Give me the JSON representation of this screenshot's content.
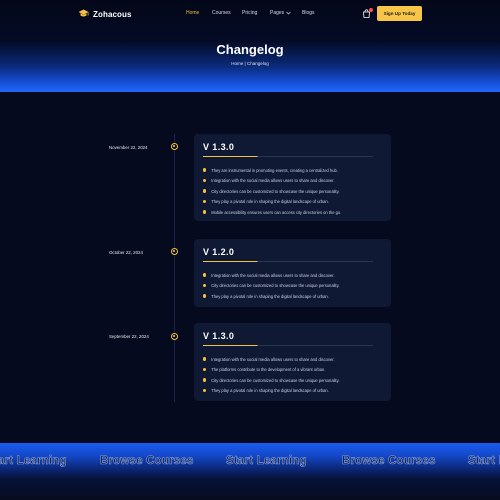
{
  "brand": {
    "name": "Zohacous",
    "accent": "#f5c142"
  },
  "nav": {
    "items": [
      {
        "label": "Home",
        "active": true
      },
      {
        "label": "Courses",
        "active": false
      },
      {
        "label": "Pricing",
        "active": false
      },
      {
        "label": "Pages",
        "active": false
      },
      {
        "label": "Blogs",
        "active": false
      }
    ],
    "cta_label": "Sign Up Today",
    "cart_icon": "shopping-bag-icon"
  },
  "hero": {
    "title": "Changelog",
    "breadcrumb": {
      "home": "Home",
      "separator": " | ",
      "current": "Changelog"
    }
  },
  "changelog": [
    {
      "date": "November 22, 2024",
      "version": "V 1.3.0",
      "items": [
        "They are instrumental in promoting events, creating a centralized hub.",
        "Integration with the social media allows users to share and discover.",
        "City directories can be customized to showcase the unique personality.",
        "They play a pivotal role in shaping the digital landscape of urban.",
        "Mobile accessibility ensures users can access city directories on the go."
      ]
    },
    {
      "date": "October 22, 2024",
      "version": "V 1.2.0",
      "items": [
        "Integration with the social media allows users to share and discover.",
        "City directories can be customized to showcase the unique personality.",
        "They play a pivotal role in shaping the digital landscape of urban."
      ]
    },
    {
      "date": "September 22, 2024",
      "version": "V 1.3.0",
      "items": [
        "Integration with the social media allows users to share and discover.",
        "The platforms contribute to the development of a vibrant urban.",
        "City directories can be customized to showcase the unique personality.",
        "They play a pivotal role in shaping the digital landscape of urban."
      ]
    }
  ],
  "marquee": [
    "Start Learning",
    "Browse Courses",
    "Start Learning",
    "Browse Courses",
    "Start Learning"
  ]
}
